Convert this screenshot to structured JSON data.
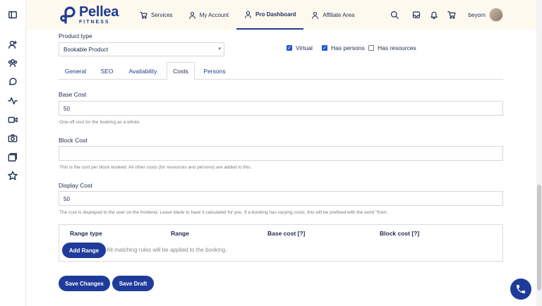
{
  "brand": {
    "name": "Pellea",
    "sub": "FITNESS",
    "color": "#1f3b8f"
  },
  "nav": {
    "items": [
      {
        "label": "Services",
        "icon": "cart-icon"
      },
      {
        "label": "My Account",
        "icon": "user-icon"
      },
      {
        "label": "Pro Dashboard",
        "icon": "user-icon",
        "active": true
      },
      {
        "label": "Affiliate Area",
        "icon": "user-icon"
      }
    ]
  },
  "user": {
    "name": "beyorn"
  },
  "form": {
    "product_type_label": "Product type",
    "product_type_value": "Bookable Product",
    "checks": [
      {
        "label": "Virtual",
        "checked": true
      },
      {
        "label": "Has persons",
        "checked": true
      },
      {
        "label": "Has resources",
        "checked": false
      }
    ],
    "tabs": [
      "General",
      "SEO",
      "Availability",
      "Costs",
      "Persons"
    ],
    "active_tab": "Costs",
    "base_cost_label": "Base Cost",
    "base_cost_value": "50",
    "base_cost_help": "One-off cost for the booking as a whole.",
    "block_cost_label": "Block Cost",
    "block_cost_value": "",
    "block_cost_help": "This is the cost per block booked. All other costs (for resources and persons) are added to this.",
    "display_cost_label": "Display Cost",
    "display_cost_value": "50",
    "display_cost_help": "The cost is displayed to the user on the frontend. Leave blank to have it calculated for you. If a booking has varying costs, this will be prefixed with the word \"from:",
    "range_headers": [
      "Range type",
      "Range",
      "Base cost [?]",
      "Block cost [?]"
    ],
    "add_range_label": "Add Range",
    "range_note": "All matching rules will be applied to the booking.",
    "save_changes_label": "Save Changes",
    "save_draft_label": "Save Draft"
  },
  "colors": {
    "accent": "#1f3b9a",
    "checkbox": "#2b56d6",
    "background": "#fdf9ef"
  }
}
